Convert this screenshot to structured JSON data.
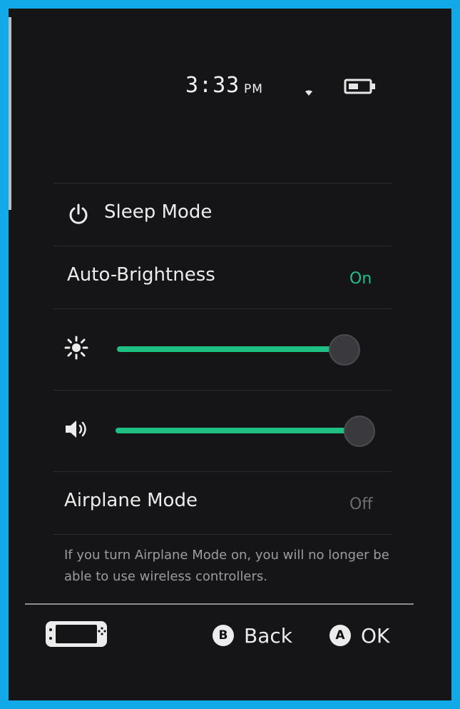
{
  "status": {
    "time": "3:33",
    "ampm": "PM",
    "wifi_icon": "wifi-icon",
    "battery_icon": "battery-icon"
  },
  "menu": {
    "sleep_mode": {
      "label": "Sleep Mode",
      "icon": "power-icon"
    },
    "auto_brightness": {
      "label": "Auto-Brightness",
      "value": "On"
    },
    "brightness_slider": {
      "icon": "sun-icon",
      "level_percent": 91
    },
    "volume_slider": {
      "icon": "speaker-icon",
      "level_percent": 95
    },
    "airplane_mode": {
      "label": "Airplane Mode",
      "value": "Off"
    },
    "airplane_note": "If you turn Airplane Mode on, you will no longer be able to use wireless controllers."
  },
  "footer": {
    "console_icon": "handheld-console-icon",
    "back": {
      "key": "B",
      "label": "Back"
    },
    "ok": {
      "key": "A",
      "label": "OK"
    }
  },
  "colors": {
    "accent": "#1fbf84",
    "border": "#12a9e8",
    "background": "#151517"
  }
}
